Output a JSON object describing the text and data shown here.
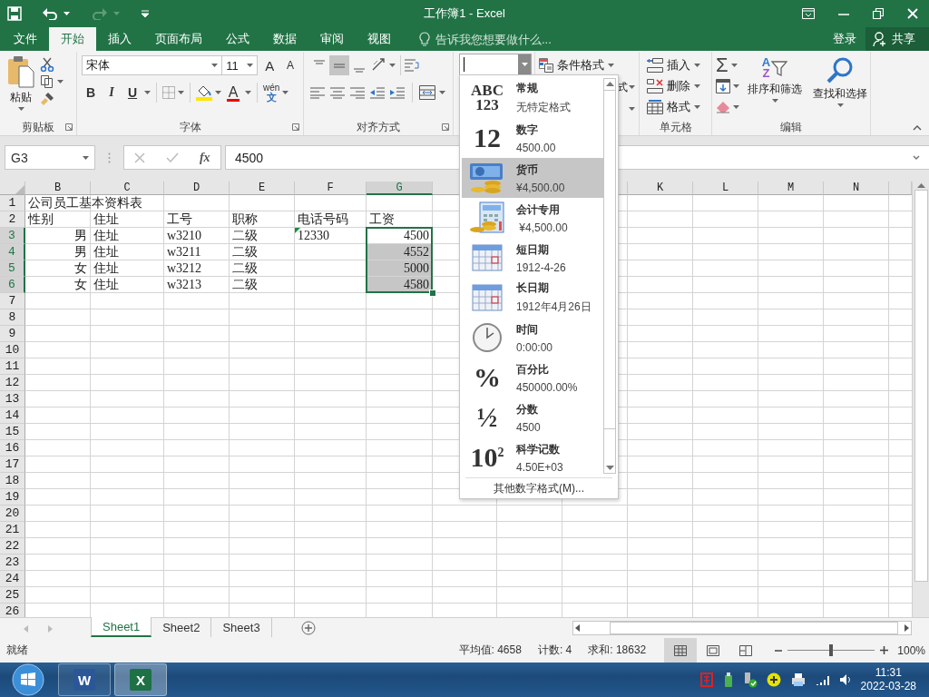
{
  "window": {
    "title": "工作簿1 - Excel"
  },
  "ribbon_tabs": [
    {
      "label": "文件",
      "selected": false
    },
    {
      "label": "开始",
      "selected": true
    },
    {
      "label": "插入",
      "selected": false
    },
    {
      "label": "页面布局",
      "selected": false
    },
    {
      "label": "公式",
      "selected": false
    },
    {
      "label": "数据",
      "selected": false
    },
    {
      "label": "审阅",
      "selected": false
    },
    {
      "label": "视图",
      "selected": false
    }
  ],
  "tell_me": {
    "placeholder": "告诉我您想要做什么..."
  },
  "account": {
    "sign_in": "登录",
    "share": "共享"
  },
  "clipboard": {
    "paste": "粘贴",
    "label": "剪贴板"
  },
  "font": {
    "name": "宋体",
    "size": "11",
    "grow": "A",
    "shrink": "A",
    "bold": "B",
    "italic": "I",
    "underline": "U",
    "color_glyph": "A",
    "phonetic_top": "wén",
    "phonetic_bottom": "文",
    "label": "字体"
  },
  "alignment": {
    "vertical": [
      {
        "kind": "top",
        "selected": false
      },
      {
        "kind": "middle",
        "selected": true
      },
      {
        "kind": "bottom",
        "selected": false
      }
    ],
    "label": "对齐方式"
  },
  "styles": {
    "conditional": "条件格式",
    "table_format": "式"
  },
  "cells": {
    "insert": "插入",
    "delete": "删除",
    "format": "格式",
    "label": "单元格"
  },
  "editing": {
    "autosum": "Σ",
    "sort_top": "A",
    "sort_bottom": "Z",
    "sort": "排序和筛选",
    "find": "查找和选择",
    "label": "编辑"
  },
  "formula_bar": {
    "name_box": "G3",
    "function": "fx",
    "value": "4500"
  },
  "sheet": {
    "columns": [
      "B",
      "C",
      "D",
      "E",
      "F",
      "G",
      null,
      null,
      null,
      "K",
      "L",
      "M",
      "N"
    ],
    "rows": [
      {
        "label": "1",
        "cells": [
          {
            "text": "公司员工基本资料表",
            "align_right": false,
            "selected": false
          }
        ]
      },
      {
        "label": "2",
        "cells": [
          {
            "text": "性别",
            "align_right": false,
            "selected": false
          },
          {
            "text": "住址",
            "align_right": false,
            "selected": false
          },
          {
            "text": "工号",
            "align_right": false,
            "selected": false
          },
          {
            "text": "职称",
            "align_right": false,
            "selected": false
          },
          {
            "text": "电话号码",
            "align_right": false,
            "selected": false
          },
          {
            "text": "工资",
            "align_right": false,
            "selected": false
          }
        ]
      },
      {
        "label": "3",
        "cells": [
          {
            "text": "男",
            "align_right": true,
            "selected": false
          },
          {
            "text": "住址",
            "align_right": false,
            "selected": false
          },
          {
            "text": "w3210",
            "align_right": false,
            "selected": false
          },
          {
            "text": "二级",
            "align_right": false,
            "selected": false
          },
          {
            "text": "12330",
            "align_right": false,
            "selected": false,
            "flag": true
          },
          {
            "text": "4500",
            "align_right": true,
            "selected": true,
            "active": true
          }
        ]
      },
      {
        "label": "4",
        "cells": [
          {
            "text": "男",
            "align_right": true,
            "selected": false
          },
          {
            "text": "住址",
            "align_right": false,
            "selected": false
          },
          {
            "text": "w3211",
            "align_right": false,
            "selected": false
          },
          {
            "text": "二级",
            "align_right": false,
            "selected": false
          },
          null,
          {
            "text": "4552",
            "align_right": true,
            "selected": true
          }
        ]
      },
      {
        "label": "5",
        "cells": [
          {
            "text": "女",
            "align_right": true,
            "selected": false
          },
          {
            "text": "住址",
            "align_right": false,
            "selected": false
          },
          {
            "text": "w3212",
            "align_right": false,
            "selected": false
          },
          {
            "text": "二级",
            "align_right": false,
            "selected": false
          },
          null,
          {
            "text": "5000",
            "align_right": true,
            "selected": true
          }
        ]
      },
      {
        "label": "6",
        "cells": [
          {
            "text": "女",
            "align_right": true,
            "selected": false
          },
          {
            "text": "住址",
            "align_right": false,
            "selected": false
          },
          {
            "text": "w3213",
            "align_right": false,
            "selected": false
          },
          {
            "text": "二级",
            "align_right": false,
            "selected": false
          },
          null,
          {
            "text": "4580",
            "align_right": true,
            "selected": true
          }
        ]
      },
      {
        "label": "7"
      },
      {
        "label": "8"
      },
      {
        "label": "9"
      },
      {
        "label": "10"
      },
      {
        "label": "11"
      },
      {
        "label": "12"
      },
      {
        "label": "13"
      },
      {
        "label": "14"
      },
      {
        "label": "15"
      },
      {
        "label": "16"
      },
      {
        "label": "17"
      },
      {
        "label": "18"
      },
      {
        "label": "19"
      },
      {
        "label": "20"
      },
      {
        "label": "21"
      },
      {
        "label": "22"
      },
      {
        "label": "23"
      },
      {
        "label": "24"
      },
      {
        "label": "25"
      },
      {
        "label": "26"
      }
    ]
  },
  "number_format_menu": {
    "items": [
      {
        "kind": "general",
        "glyph": "ABC 123",
        "name": "常规",
        "example": "无特定格式",
        "selected": false
      },
      {
        "kind": "number",
        "glyph": "12",
        "name": "数字",
        "example": "4500.00",
        "selected": false
      },
      {
        "kind": "currency",
        "name": "货币",
        "example": "¥4,500.00",
        "selected": true
      },
      {
        "kind": "accounting",
        "name": "会计专用",
        "example": " ¥4,500.00",
        "selected": false
      },
      {
        "kind": "short_date",
        "name": "短日期",
        "example": "1912-4-26",
        "selected": false
      },
      {
        "kind": "long_date",
        "name": "长日期",
        "example": "1912年4月26日",
        "selected": false
      },
      {
        "kind": "time",
        "name": "时间",
        "example": "0:00:00",
        "selected": false
      },
      {
        "kind": "percentage",
        "glyph": "%",
        "name": "百分比",
        "example": "450000.00%",
        "selected": false
      },
      {
        "kind": "fraction",
        "glyph": "½",
        "name": "分数",
        "example": "4500",
        "selected": false
      },
      {
        "kind": "scientific",
        "glyph": "10$^{2}$",
        "name": "科学记数",
        "example": "4.50E+03",
        "selected": false
      }
    ],
    "more": "其他数字格式(M)..."
  },
  "sheet_tabs": [
    {
      "label": "Sheet1",
      "selected": true
    },
    {
      "label": "Sheet2",
      "selected": false
    },
    {
      "label": "Sheet3",
      "selected": false
    }
  ],
  "status_bar": {
    "ready": "就绪",
    "stats": [
      "平均值: 4658",
      "计数: 4",
      "求和: 18632"
    ],
    "views": [
      {
        "kind": "normal",
        "selected": true
      },
      {
        "kind": "page_layout",
        "selected": false
      },
      {
        "kind": "page_break",
        "selected": false
      }
    ],
    "zoom": {
      "level": 0.5,
      "reading": "100%"
    }
  },
  "taskbar": {
    "apps": [
      {
        "kind": "word",
        "glyph": "W",
        "selected": false
      },
      {
        "kind": "excel",
        "glyph": "X",
        "selected": true
      }
    ],
    "time": "11:31",
    "date": "2022-03-28"
  }
}
